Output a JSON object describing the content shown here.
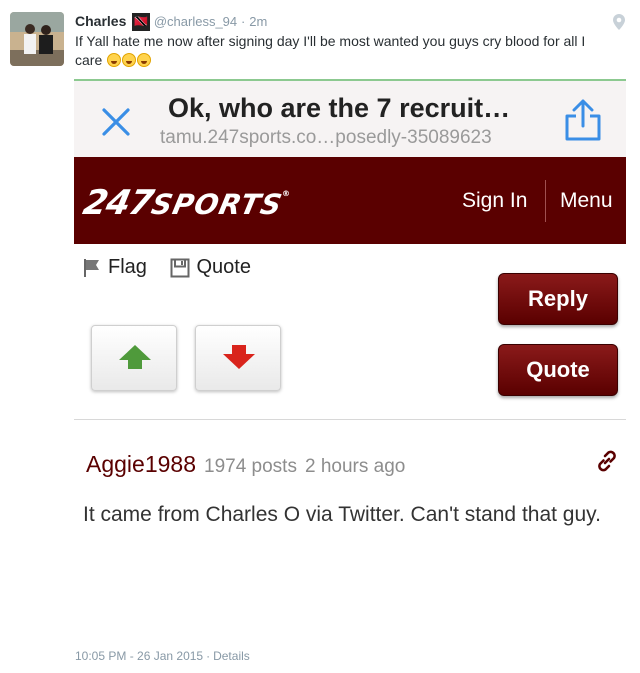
{
  "tweet": {
    "name": "Charles",
    "flag_text": "🇹🇹",
    "handle": "@charless_94",
    "separator": "·",
    "time_ago": "2m",
    "text": "If Yall hate me now after signing day I'll be most wanted you guys cry blood for all I care",
    "emoji_names": [
      "face-with-tears-of-joy",
      "face-with-tears-of-joy",
      "face-with-tears-of-joy"
    ]
  },
  "screenshot": {
    "browser": {
      "page_title": "Ok, who are the 7 recruit…",
      "url": "tamu.247sports.co…posedly-35089623",
      "close_icon": "close-icon",
      "share_icon": "share-icon"
    },
    "site": {
      "logo_number": "247",
      "logo_word": "SPORTS",
      "logo_mark": "®",
      "sign_in": "Sign In",
      "menu": "Menu",
      "brand_color": "#5a0000"
    },
    "actions": {
      "flag": "Flag",
      "quote_link": "Quote",
      "reply_button": "Reply",
      "quote_button": "Quote",
      "upvote_icon": "arrow-up-icon",
      "downvote_icon": "arrow-down-icon"
    },
    "post": {
      "username": "Aggie1988",
      "post_count": "1974 posts",
      "time_ago": "2 hours ago",
      "body": "It came from Charles O via Twitter. Can't stand that guy."
    }
  },
  "footer": {
    "timestamp": "10:05 PM - 26 Jan 2015",
    "separator": "·",
    "details": "Details"
  },
  "colors": {
    "twitter_gray": "#8899a6",
    "upvote_green": "#4f9a3b",
    "downvote_red": "#d9241c"
  }
}
